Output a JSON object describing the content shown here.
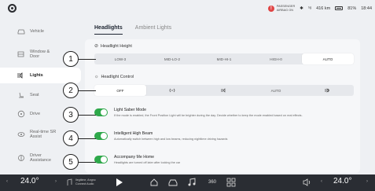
{
  "status": {
    "airbag_line1": "PASSENGER",
    "airbag_line2": "AIRBAG ON",
    "bluetooth": "✱",
    "signal": "⁵ᵍ",
    "range": "416 km",
    "battery": "81%",
    "time": "18:44"
  },
  "sidebar": {
    "items": [
      {
        "label": "Vehicle"
      },
      {
        "label": "Window &\nDoor"
      },
      {
        "label": "Lights"
      },
      {
        "label": "Seat"
      },
      {
        "label": "Drive"
      },
      {
        "label": "Real-time SR\nAssist"
      },
      {
        "label": "Driver\nAssistance"
      }
    ]
  },
  "tabs": [
    "Headlights",
    "Ambient Lights"
  ],
  "headlight_height": {
    "title": "Headlight Height",
    "options": [
      "LOW-3",
      "MID-LO-2",
      "MID-HI-1",
      "HIGH-0",
      "AUTO"
    ]
  },
  "headlight_control": {
    "title": "Headlight Control",
    "options": [
      "OFF",
      "AUTO"
    ]
  },
  "toggles": [
    {
      "title": "Light Saber Mode",
      "desc": "If the mode is enabled, the Front Position Light will be brighter during the day. Decide whether to keep the mode enabled based on real effects."
    },
    {
      "title": "Intelligent High Beam",
      "desc": "Automatically switch between high and low beams, reducing nighttime driving hazards"
    },
    {
      "title": "Accompany Me Home",
      "desc": "Headlights are turned off later after locking the car"
    }
  ],
  "callouts": [
    "1",
    "2",
    "3",
    "4",
    "5"
  ],
  "dock": {
    "left_temp": "24.0°",
    "right_temp": "24.0°",
    "media_line1": "Ilegitime, Angno",
    "media_line2": "Connect Audio",
    "aux_label": "360"
  }
}
